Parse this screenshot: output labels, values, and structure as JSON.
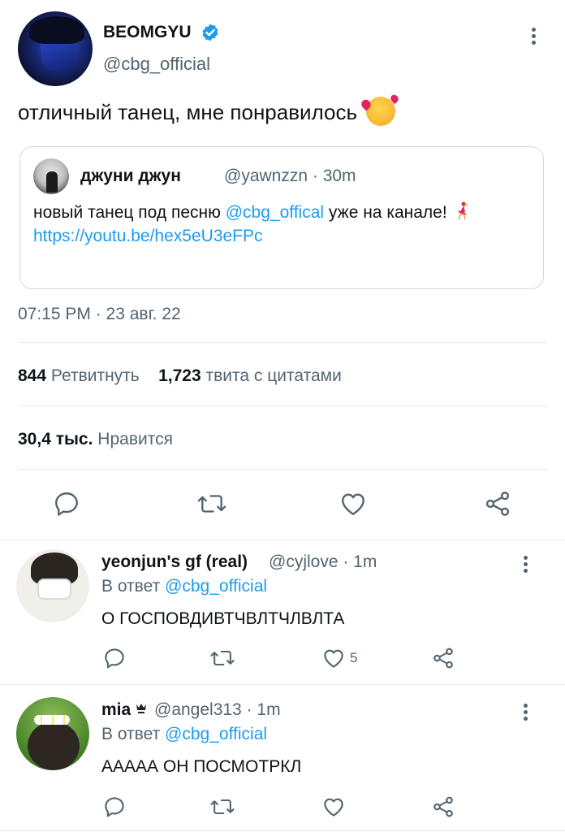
{
  "main_tweet": {
    "author_name": "BEOMGYU",
    "author_handle": "@cbg_official",
    "text": "отличный танец, мне понравилось",
    "emoji": "smiling-face-with-hearts",
    "timestamp": "07:15 PM · 23 авг. 22",
    "quoted": {
      "author_name": "джуни джун",
      "author_handle": "@yawnzzn",
      "time_ago": "· 30m",
      "text_before": "новый танец под песню",
      "mention": "@cbg_offical",
      "text_after": "уже на канале!",
      "emoji": "dancer",
      "link": "https://youtu.be/hex5eU3eFPc"
    },
    "stats": {
      "retweets_count": "844",
      "retweets_label": "Ретвитнуть",
      "quotes_count": "1,723",
      "quotes_label": "твита с цитатами",
      "likes_count": "30,4 тыс.",
      "likes_label": "Нравится"
    }
  },
  "replies": [
    {
      "author_name": "yeonjun's gf (real)",
      "author_handle": "@cyjlove",
      "time_ago": "· 1m",
      "reply_prefix": "В ответ",
      "reply_to": "@cbg_official",
      "text": "О ГОСПОВДИВТЧВЛТЧЛВЛТА",
      "likes": "5"
    },
    {
      "author_name": "mia",
      "author_handle": "@angel313",
      "time_ago": "· 1m",
      "reply_prefix": "В ответ",
      "reply_to": "@cbg_official",
      "text": "АААAА ОН ПОСМОТРКЛ",
      "likes": ""
    }
  ],
  "colors": {
    "accent": "#1d9bf0",
    "secondary_text": "#536471",
    "primary_text": "#0f1419",
    "divider": "#e7e9ea"
  },
  "icons": [
    "verified-badge-icon",
    "more-options-icon",
    "reply-icon",
    "retweet-icon",
    "like-icon",
    "share-icon",
    "crown-icon"
  ]
}
